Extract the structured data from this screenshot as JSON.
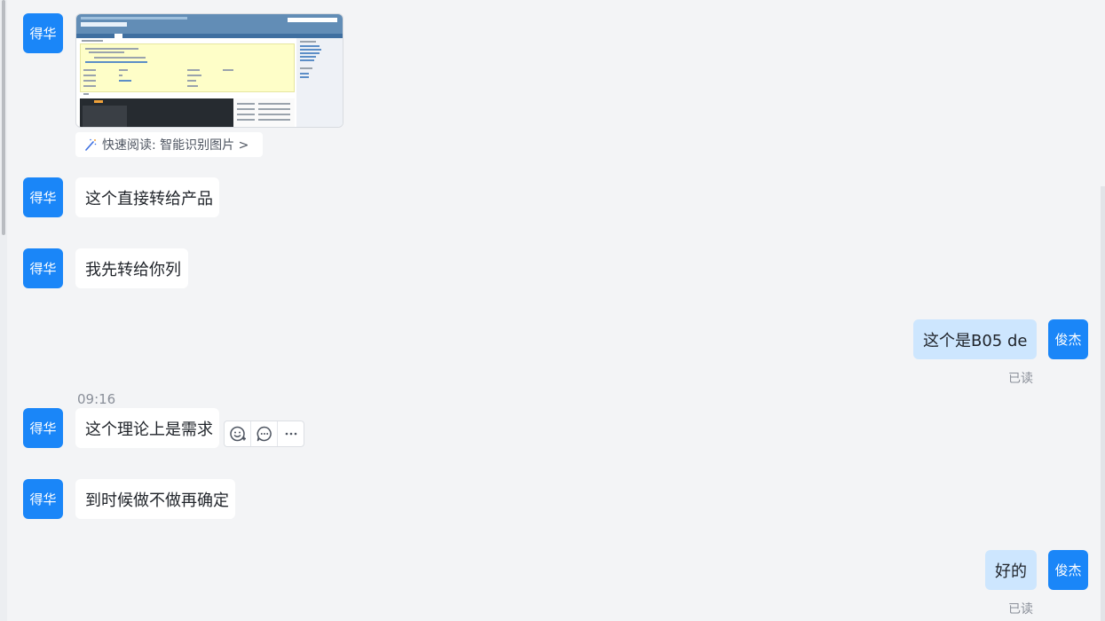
{
  "messages": [
    {
      "sender": "得华",
      "type": "image",
      "quick_read": "快速阅读: 智能识别图片 >"
    },
    {
      "sender": "得华",
      "text": "这个直接转给产品"
    },
    {
      "sender": "得华",
      "text": "我先转给你列"
    },
    {
      "sender": "俊杰",
      "text": "这个是B05 de",
      "status": "已读"
    },
    {
      "sender": "得华",
      "time": "09:16",
      "text": "这个理论上是需求"
    },
    {
      "sender": "得华",
      "text": "到时候做不做再确定"
    },
    {
      "sender": "俊杰",
      "text": "好的",
      "status": "已读"
    }
  ],
  "hover_actions": [
    "emoji-reaction-icon",
    "reply-icon",
    "more-icon"
  ],
  "colors": {
    "avatar": "#1a86f8",
    "background": "#f3f4f6",
    "incoming_bubble": "#ffffff",
    "outgoing_bubble": "#cde6fe"
  }
}
